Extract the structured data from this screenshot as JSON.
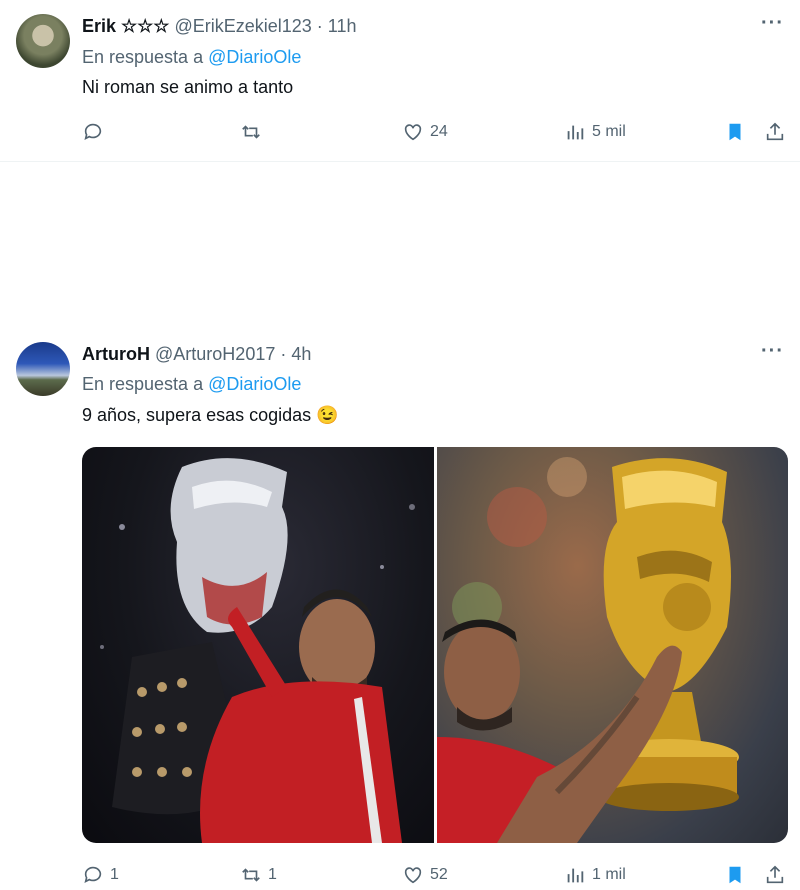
{
  "tweets": [
    {
      "name": "Erik ☆☆☆",
      "handle": "@ErikEzekiel123 · 11h",
      "reply_prefix": "En respuesta a ",
      "reply_to": "@DiarioOle",
      "text": "Ni roman se animo a tanto",
      "actions": {
        "replies": "",
        "retweets": "",
        "likes": "24",
        "views": "5 mil"
      }
    },
    {
      "name": "ArturoH",
      "handle": "@ArturoH2017 · 4h",
      "reply_prefix": "En respuesta a ",
      "reply_to": "@DiarioOle",
      "text": "9 años, supera esas cogidas 😉",
      "actions": {
        "replies": "1",
        "retweets": "1",
        "likes": "52",
        "views": "1 mil"
      }
    }
  ],
  "more_icon": "···",
  "colors": {
    "accent": "#1d9bf0",
    "muted": "#536471",
    "text": "#0f1419",
    "divider": "#eff3f4"
  }
}
